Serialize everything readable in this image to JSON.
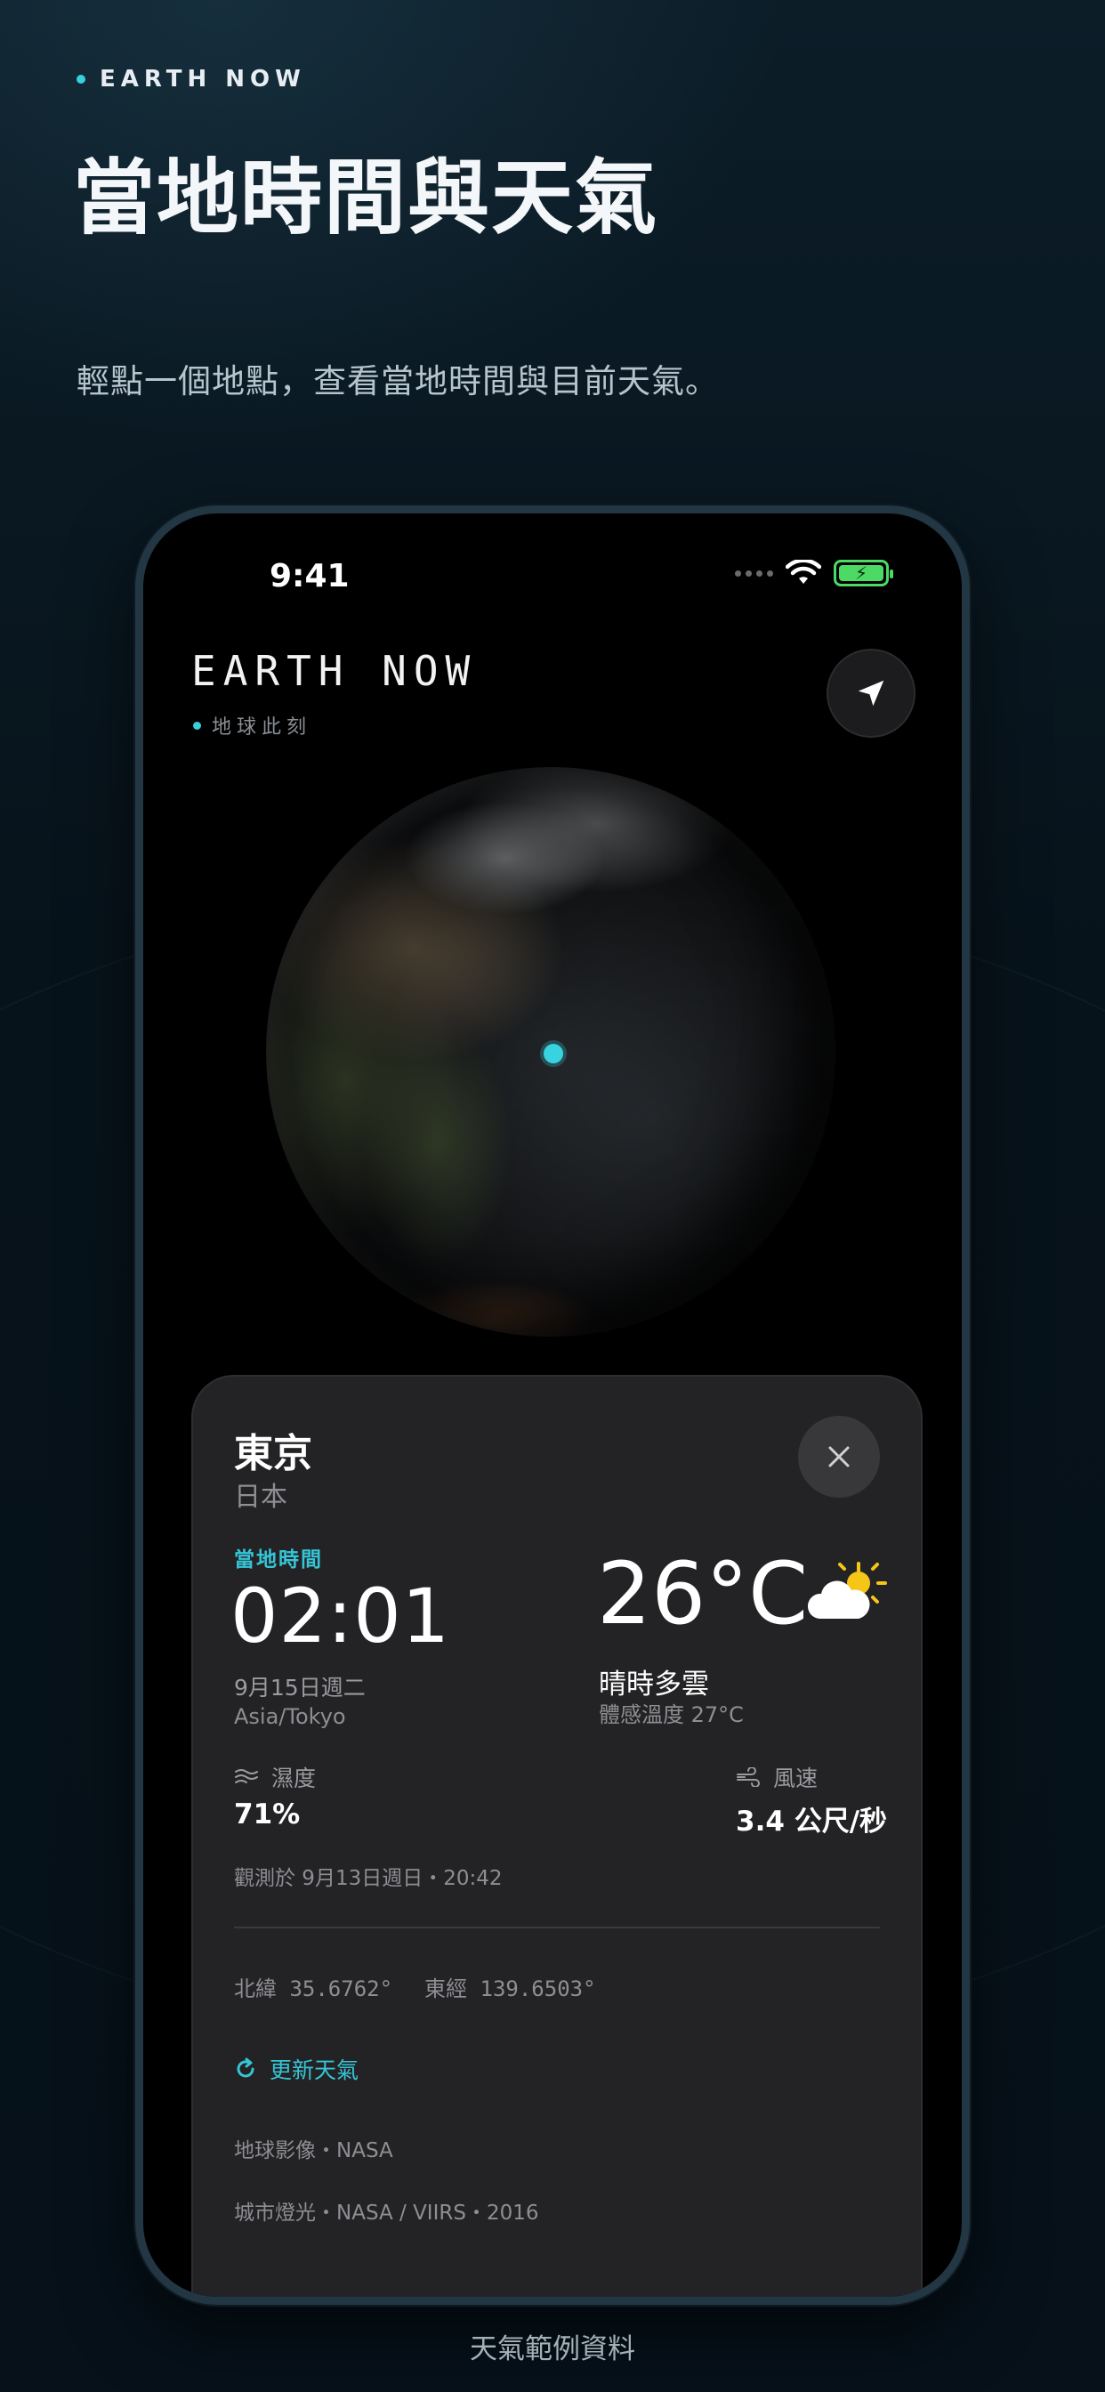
{
  "promo": {
    "kicker": "EARTH NOW",
    "headline": "當地時間與天氣",
    "subline": "輕點一個地點，查看當地時間與目前天氣。",
    "caption": "天氣範例資料",
    "accent_color": "#36d1dc"
  },
  "status_bar": {
    "time": "9:41",
    "icons": [
      "signal-dots-icon",
      "wifi-icon",
      "battery-charging-icon"
    ]
  },
  "app": {
    "title": "EARTH NOW",
    "subtitle": "地球此刻",
    "locate_icon": "location-arrow-icon"
  },
  "card": {
    "city": "東京",
    "country": "日本",
    "local_time_label": "當地時間",
    "local_time": "02:01",
    "date": "9月15日週二",
    "timezone": "Asia/Tokyo",
    "temperature": "26°C",
    "condition": "晴時多雲",
    "feels_like": "體感溫度 27°C",
    "weather_icon": "partly-sunny-icon",
    "humidity": {
      "label": "濕度",
      "value": "71%",
      "icon": "humidity-icon"
    },
    "wind": {
      "label": "風速",
      "value": "3.4 公尺/秒",
      "icon": "wind-icon"
    },
    "observed": "觀測於 9月13日週日・20:42",
    "latitude": "北緯 35.6762°",
    "longitude": "東經 139.6503°",
    "refresh_label": "更新天氣",
    "credit_imagery": "地球影像・NASA",
    "credit_lights": "城市燈光・NASA / VIIRS・2016"
  }
}
